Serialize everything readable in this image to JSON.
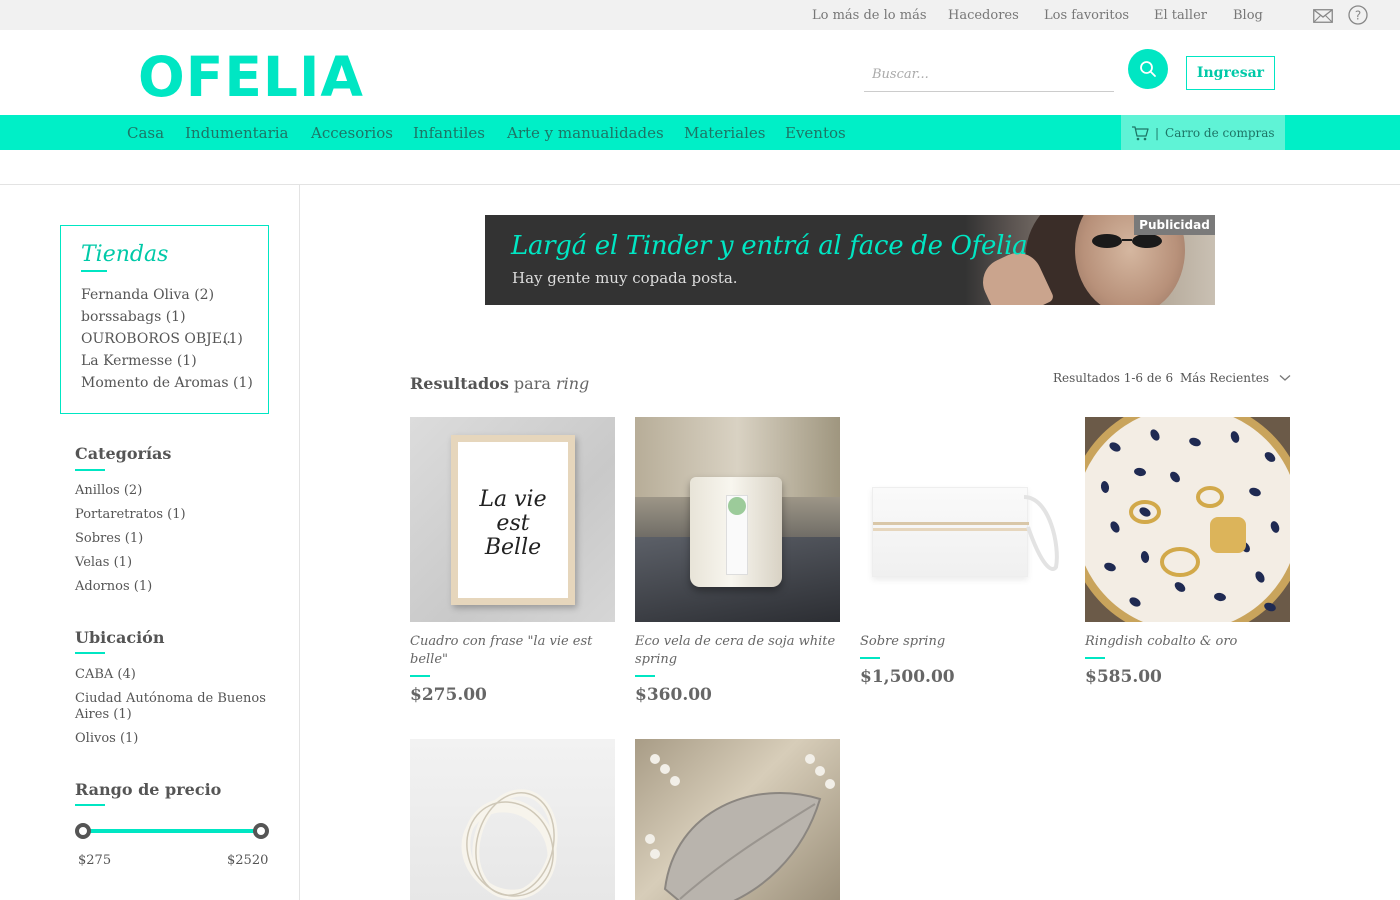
{
  "topnav": {
    "links": [
      "Lo más de lo más",
      "Hacedores",
      "Los favoritos",
      "El taller",
      "Blog"
    ]
  },
  "header": {
    "logo_text": "OFELIA",
    "search_placeholder": "Buscar...",
    "login_label": "Ingresar"
  },
  "categories": [
    "Casa",
    "Indumentaria",
    "Accesorios",
    "Infantiles",
    "Arte y manualidades",
    "Materiales",
    "Eventos"
  ],
  "cart": {
    "label": "Carro de compras",
    "separator": "|"
  },
  "sidebar": {
    "stores": {
      "title": "Tiendas",
      "items": [
        {
          "name": "Fernanda Oliva (2)",
          "count": ""
        },
        {
          "name": "borssabags (1)",
          "count": ""
        },
        {
          "name": "OUROBOROS OBJE...",
          "count": "(1)"
        },
        {
          "name": "La Kermesse (1)",
          "count": ""
        },
        {
          "name": "Momento de Aromas (1)",
          "count": ""
        }
      ]
    },
    "categories": {
      "title": "Categorías",
      "items": [
        "Anillos (2)",
        "Portaretratos (1)",
        "Sobres (1)",
        "Velas (1)",
        "Adornos (1)"
      ]
    },
    "location": {
      "title": "Ubicación",
      "items": [
        "CABA (4)",
        "Ciudad Autónoma de Buenos Aires (1)",
        "Olivos (1)"
      ]
    },
    "price_range": {
      "title": "Rango de precio",
      "min": "$275",
      "max": "$2520"
    }
  },
  "ad": {
    "headline": "Largá el Tinder y entrá al face de Ofelia",
    "subline": "Hay gente muy copada posta.",
    "badge": "Publicidad"
  },
  "results": {
    "label": "Resultados",
    "connector": "para",
    "query": "ring",
    "count_text": "Resultados 1-6 de 6",
    "sort_label": "Más Recientes"
  },
  "products": [
    {
      "name": "Cuadro con frase \"la vie est belle\"",
      "price": "$275.00",
      "art_text": [
        "La vie",
        "est",
        "Belle"
      ]
    },
    {
      "name": "Eco vela de cera de soja white spring",
      "price": "$360.00"
    },
    {
      "name": "Sobre spring",
      "price": "$1,500.00"
    },
    {
      "name": "Ringdish cobalto & oro",
      "price": "$585.00"
    },
    {
      "name": "",
      "price": ""
    },
    {
      "name": "",
      "price": ""
    }
  ],
  "colors": {
    "accent": "#00e6c3",
    "catbar": "#00efc7",
    "text": "#555555"
  }
}
